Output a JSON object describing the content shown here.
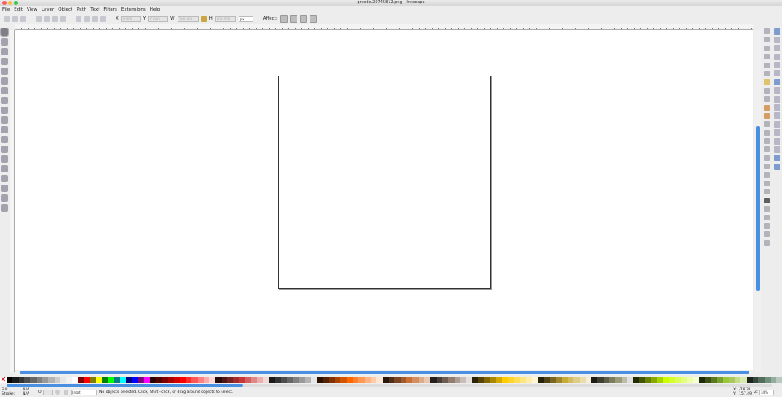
{
  "window": {
    "title": "qrcode.20745812.png – Inkscape"
  },
  "menu": [
    "File",
    "Edit",
    "View",
    "Layer",
    "Object",
    "Path",
    "Text",
    "Filters",
    "Extensions",
    "Help"
  ],
  "toolbar": {
    "x_label": "X",
    "x_value": "0.000",
    "y_label": "Y",
    "y_value": "0.000",
    "w_label": "W",
    "w_value": "200.000",
    "h_label": "H",
    "h_value": "200.000",
    "unit": "px",
    "affect_label": "Affect:"
  },
  "statusbar": {
    "fill_label": "Fill:",
    "fill_value": "N/A",
    "stroke_label": "Stroke:",
    "stroke_value": "N/A",
    "opacity_label": "O:",
    "layer": "(root)",
    "message": "No objects selected. Click, Shift+click, or drag around objects to select.",
    "x_label": "X:",
    "x_value": "-78.31",
    "y_label": "Y:",
    "y_value": "157.49",
    "zoom_label": "Z:",
    "zoom_value": "34%"
  },
  "colors": {
    "accent": "#4a90e2"
  },
  "palette": [
    "#000000",
    "#1a1a1a",
    "#333333",
    "#4d4d4d",
    "#666666",
    "#808080",
    "#999999",
    "#b3b3b3",
    "#cccccc",
    "#e6e6e6",
    "#f2f2f2",
    "#ffffff",
    "#800000",
    "#ff0000",
    "#808000",
    "#ffff00",
    "#008000",
    "#00ff00",
    "#008080",
    "#00ffff",
    "#000080",
    "#0000ff",
    "#800080",
    "#ff00ff",
    "#2b0000",
    "#550000",
    "#800000",
    "#aa0000",
    "#d40000",
    "#ff0000",
    "#ff2a2a",
    "#ff5555",
    "#ff8080",
    "#ffaaaa",
    "#ffd5d5",
    "#280b0b",
    "#501616",
    "#782121",
    "#a02c2c",
    "#c83737",
    "#d35f5f",
    "#de8787",
    "#e9afaf",
    "#f4d7d7",
    "#1a1a1a",
    "#333333",
    "#4d4d4d",
    "#666666",
    "#808080",
    "#999999",
    "#b3b3b3",
    "#e6e6e6",
    "#2b1100",
    "#552200",
    "#803300",
    "#aa4400",
    "#d45500",
    "#ff6600",
    "#ff7f2a",
    "#ff9955",
    "#ffb380",
    "#ffccaa",
    "#ffe6d5",
    "#28170b",
    "#502d16",
    "#784421",
    "#a05a2c",
    "#c87137",
    "#d38d5f",
    "#deaa87",
    "#e9c6af",
    "#241f1c",
    "#483e37",
    "#6c5d53",
    "#917c6f",
    "#ac9d93",
    "#c8beb7",
    "#e3dedb",
    "#2b2200",
    "#554400",
    "#806600",
    "#aa8800",
    "#d4aa00",
    "#ffcc00",
    "#ffd42a",
    "#ffdd55",
    "#ffe680",
    "#ffeeaa",
    "#fff6d5",
    "#28220b",
    "#504416",
    "#786721",
    "#a0892c",
    "#c8ab37",
    "#d3bc5f",
    "#decd87",
    "#e9ddaf",
    "#f4eed7",
    "#1c1c14",
    "#3e3e30",
    "#5d5d48",
    "#7c7c5f",
    "#9b9b78",
    "#bcbcac",
    "#dedede",
    "#222b00",
    "#445500",
    "#668000",
    "#88aa00",
    "#aad400",
    "#ccff00",
    "#d4ff2a",
    "#ddff55",
    "#e5ff80",
    "#eeffaa",
    "#f6ffd5",
    "#1e2b0b",
    "#3c5016",
    "#5a7821",
    "#78a02c",
    "#99c837",
    "#abc65f",
    "#c4dd87",
    "#d6e9af",
    "#1c241c",
    "#37483e",
    "#536c5d",
    "#6f917c",
    "#93ac9d",
    "#b7c8be"
  ]
}
